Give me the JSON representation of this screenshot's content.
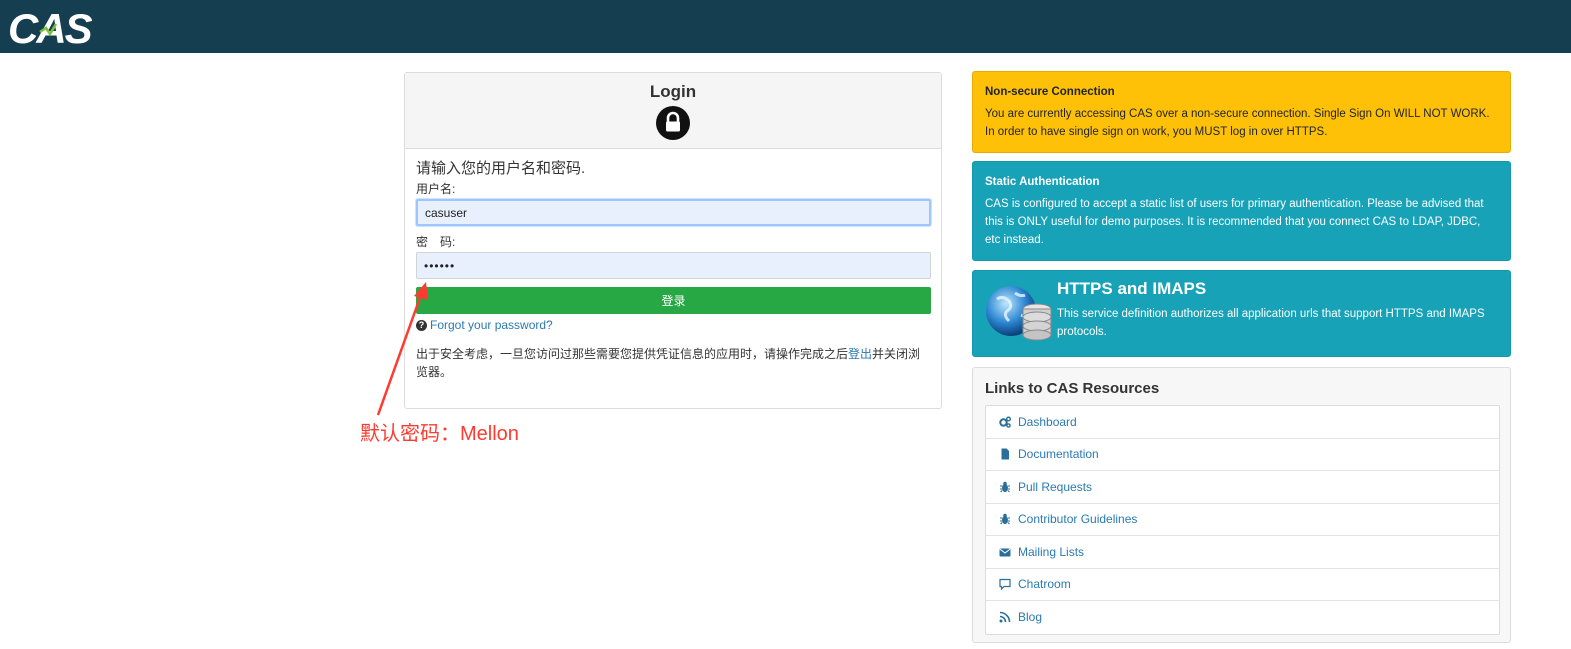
{
  "header": {
    "logo_text": "CAS",
    "background_color": "#153e50"
  },
  "login": {
    "title": "Login",
    "lock_icon": "lock-icon",
    "prompt": "请输入您的用户名和密码.",
    "username_label": "用户名:",
    "username_value": "casuser",
    "password_label": "密　码:",
    "password_value": "••••••",
    "submit_label": "登录",
    "forgot_label": "Forgot your password?",
    "notice_before": "出于安全考虑，一旦您访问过那些需要您提供凭证信息的应用时，请操作完成之后",
    "notice_link": "登出",
    "notice_after": "并关闭浏览器。",
    "accent_color": "#28a745"
  },
  "annotation": {
    "text": "默认密码：Mellon",
    "color": "#ff3b30"
  },
  "alerts": {
    "nonsecure": {
      "title": "Non-secure Connection",
      "text": "You are currently accessing CAS over a non-secure connection. Single Sign On WILL NOT WORK. In order to have single sign on work, you MUST log in over HTTPS.",
      "color": "#ffc107"
    },
    "static_auth": {
      "title": "Static Authentication",
      "text": "CAS is configured to accept a static list of users for primary authentication. Please be advised that this is ONLY useful for demo purposes. It is recommended that you connect CAS to LDAP, JDBC, etc instead.",
      "color": "#17a2b8"
    },
    "https": {
      "title": "HTTPS and IMAPS",
      "text": "This service definition authorizes all application urls that support HTTPS and IMAPS protocols.",
      "icon": "globe-database-icon"
    }
  },
  "resources": {
    "title": "Links to CAS Resources",
    "items": [
      {
        "label": "Dashboard",
        "icon": "gears-icon"
      },
      {
        "label": "Documentation",
        "icon": "file-icon"
      },
      {
        "label": "Pull Requests",
        "icon": "bug-icon"
      },
      {
        "label": "Contributor Guidelines",
        "icon": "bug-icon"
      },
      {
        "label": "Mailing Lists",
        "icon": "envelope-icon"
      },
      {
        "label": "Chatroom",
        "icon": "comment-icon"
      },
      {
        "label": "Blog",
        "icon": "rss-icon"
      }
    ]
  }
}
